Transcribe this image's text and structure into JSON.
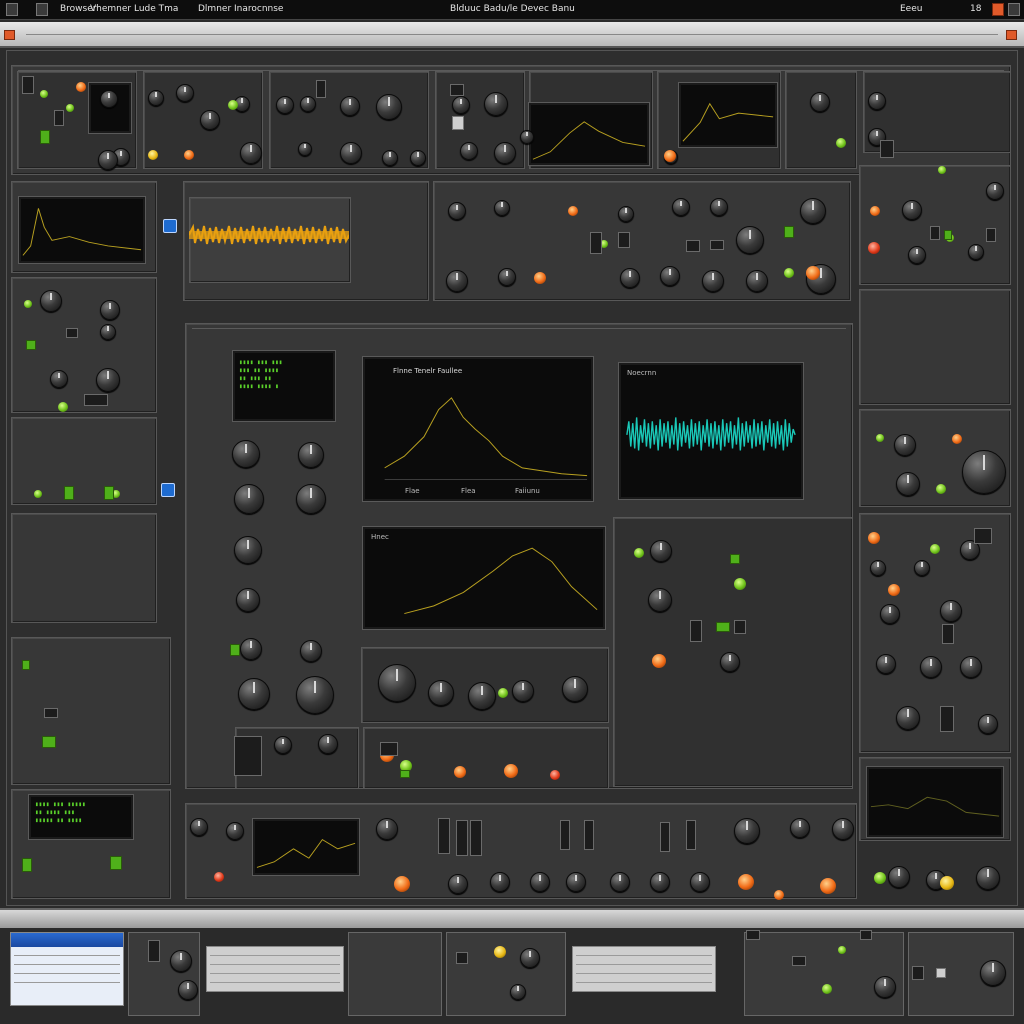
{
  "app": {
    "menu": [
      "Browser",
      "Vhemner Lude Tma",
      "Dlmner Inarocnnse",
      "Blduuc Badu/le Devec Banu",
      "Eeeu",
      "18"
    ],
    "colors": {
      "accent_green": "#6fc21a",
      "accent_orange": "#f06a16",
      "waveform_orange": "#e8a010",
      "waveform_teal": "#1ac8b8"
    }
  },
  "panels": {
    "filter_screen_title": "Flnne Tenelr Faullee",
    "spectrum_label": "Noecrnn",
    "envelope_label": "Hnec",
    "display_buttons": [
      "Flae",
      "Flea",
      "Faiiunu"
    ]
  }
}
